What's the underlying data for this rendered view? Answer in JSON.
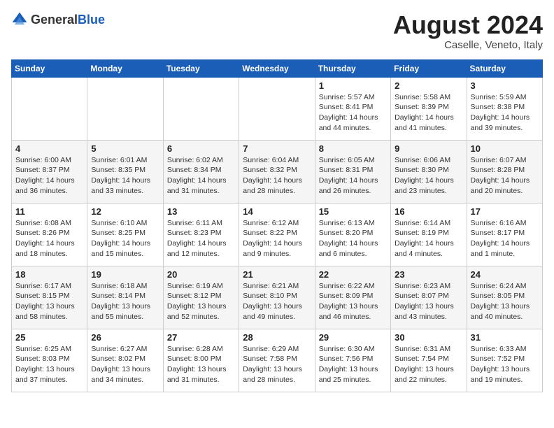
{
  "header": {
    "logo_general": "General",
    "logo_blue": "Blue",
    "month_year": "August 2024",
    "location": "Caselle, Veneto, Italy"
  },
  "days_of_week": [
    "Sunday",
    "Monday",
    "Tuesday",
    "Wednesday",
    "Thursday",
    "Friday",
    "Saturday"
  ],
  "weeks": [
    [
      {
        "day": "",
        "info": ""
      },
      {
        "day": "",
        "info": ""
      },
      {
        "day": "",
        "info": ""
      },
      {
        "day": "",
        "info": ""
      },
      {
        "day": "1",
        "info": "Sunrise: 5:57 AM\nSunset: 8:41 PM\nDaylight: 14 hours\nand 44 minutes."
      },
      {
        "day": "2",
        "info": "Sunrise: 5:58 AM\nSunset: 8:39 PM\nDaylight: 14 hours\nand 41 minutes."
      },
      {
        "day": "3",
        "info": "Sunrise: 5:59 AM\nSunset: 8:38 PM\nDaylight: 14 hours\nand 39 minutes."
      }
    ],
    [
      {
        "day": "4",
        "info": "Sunrise: 6:00 AM\nSunset: 8:37 PM\nDaylight: 14 hours\nand 36 minutes."
      },
      {
        "day": "5",
        "info": "Sunrise: 6:01 AM\nSunset: 8:35 PM\nDaylight: 14 hours\nand 33 minutes."
      },
      {
        "day": "6",
        "info": "Sunrise: 6:02 AM\nSunset: 8:34 PM\nDaylight: 14 hours\nand 31 minutes."
      },
      {
        "day": "7",
        "info": "Sunrise: 6:04 AM\nSunset: 8:32 PM\nDaylight: 14 hours\nand 28 minutes."
      },
      {
        "day": "8",
        "info": "Sunrise: 6:05 AM\nSunset: 8:31 PM\nDaylight: 14 hours\nand 26 minutes."
      },
      {
        "day": "9",
        "info": "Sunrise: 6:06 AM\nSunset: 8:30 PM\nDaylight: 14 hours\nand 23 minutes."
      },
      {
        "day": "10",
        "info": "Sunrise: 6:07 AM\nSunset: 8:28 PM\nDaylight: 14 hours\nand 20 minutes."
      }
    ],
    [
      {
        "day": "11",
        "info": "Sunrise: 6:08 AM\nSunset: 8:26 PM\nDaylight: 14 hours\nand 18 minutes."
      },
      {
        "day": "12",
        "info": "Sunrise: 6:10 AM\nSunset: 8:25 PM\nDaylight: 14 hours\nand 15 minutes."
      },
      {
        "day": "13",
        "info": "Sunrise: 6:11 AM\nSunset: 8:23 PM\nDaylight: 14 hours\nand 12 minutes."
      },
      {
        "day": "14",
        "info": "Sunrise: 6:12 AM\nSunset: 8:22 PM\nDaylight: 14 hours\nand 9 minutes."
      },
      {
        "day": "15",
        "info": "Sunrise: 6:13 AM\nSunset: 8:20 PM\nDaylight: 14 hours\nand 6 minutes."
      },
      {
        "day": "16",
        "info": "Sunrise: 6:14 AM\nSunset: 8:19 PM\nDaylight: 14 hours\nand 4 minutes."
      },
      {
        "day": "17",
        "info": "Sunrise: 6:16 AM\nSunset: 8:17 PM\nDaylight: 14 hours\nand 1 minute."
      }
    ],
    [
      {
        "day": "18",
        "info": "Sunrise: 6:17 AM\nSunset: 8:15 PM\nDaylight: 13 hours\nand 58 minutes."
      },
      {
        "day": "19",
        "info": "Sunrise: 6:18 AM\nSunset: 8:14 PM\nDaylight: 13 hours\nand 55 minutes."
      },
      {
        "day": "20",
        "info": "Sunrise: 6:19 AM\nSunset: 8:12 PM\nDaylight: 13 hours\nand 52 minutes."
      },
      {
        "day": "21",
        "info": "Sunrise: 6:21 AM\nSunset: 8:10 PM\nDaylight: 13 hours\nand 49 minutes."
      },
      {
        "day": "22",
        "info": "Sunrise: 6:22 AM\nSunset: 8:09 PM\nDaylight: 13 hours\nand 46 minutes."
      },
      {
        "day": "23",
        "info": "Sunrise: 6:23 AM\nSunset: 8:07 PM\nDaylight: 13 hours\nand 43 minutes."
      },
      {
        "day": "24",
        "info": "Sunrise: 6:24 AM\nSunset: 8:05 PM\nDaylight: 13 hours\nand 40 minutes."
      }
    ],
    [
      {
        "day": "25",
        "info": "Sunrise: 6:25 AM\nSunset: 8:03 PM\nDaylight: 13 hours\nand 37 minutes."
      },
      {
        "day": "26",
        "info": "Sunrise: 6:27 AM\nSunset: 8:02 PM\nDaylight: 13 hours\nand 34 minutes."
      },
      {
        "day": "27",
        "info": "Sunrise: 6:28 AM\nSunset: 8:00 PM\nDaylight: 13 hours\nand 31 minutes."
      },
      {
        "day": "28",
        "info": "Sunrise: 6:29 AM\nSunset: 7:58 PM\nDaylight: 13 hours\nand 28 minutes."
      },
      {
        "day": "29",
        "info": "Sunrise: 6:30 AM\nSunset: 7:56 PM\nDaylight: 13 hours\nand 25 minutes."
      },
      {
        "day": "30",
        "info": "Sunrise: 6:31 AM\nSunset: 7:54 PM\nDaylight: 13 hours\nand 22 minutes."
      },
      {
        "day": "31",
        "info": "Sunrise: 6:33 AM\nSunset: 7:52 PM\nDaylight: 13 hours\nand 19 minutes."
      }
    ]
  ]
}
